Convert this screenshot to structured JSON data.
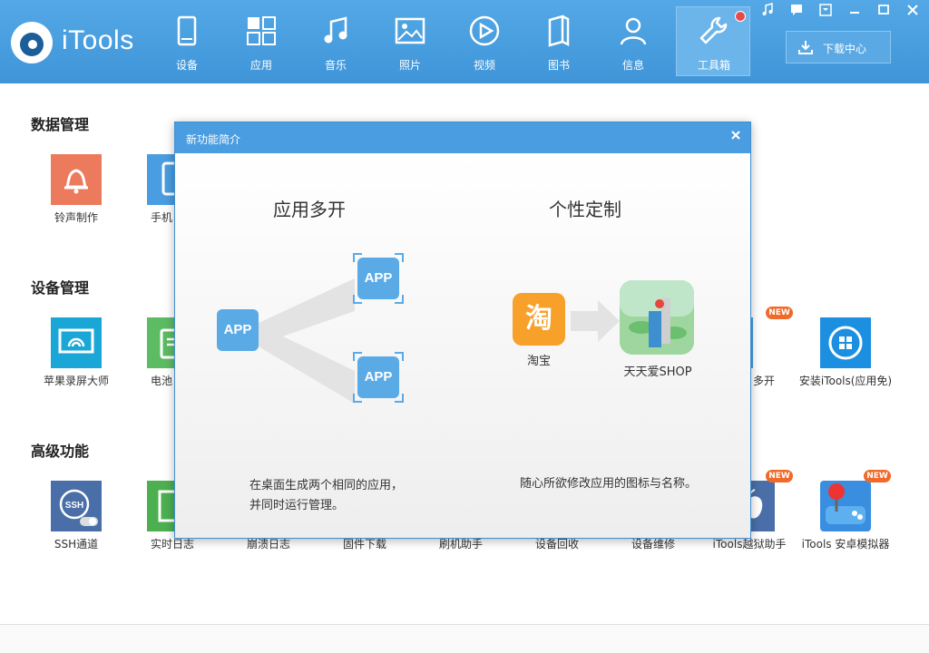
{
  "app": {
    "logo_text": "iTools"
  },
  "nav": [
    {
      "label": "设备",
      "icon": "tablet-icon"
    },
    {
      "label": "应用",
      "icon": "apps-grid-icon"
    },
    {
      "label": "音乐",
      "icon": "music-note-icon"
    },
    {
      "label": "照片",
      "icon": "photo-icon"
    },
    {
      "label": "视频",
      "icon": "play-icon"
    },
    {
      "label": "图书",
      "icon": "book-icon"
    },
    {
      "label": "信息",
      "icon": "person-icon"
    },
    {
      "label": "工具箱",
      "icon": "wrench-icon",
      "active": true
    }
  ],
  "download_button": {
    "label": "下载中心"
  },
  "sections": {
    "data_management": "数据管理",
    "device_management": "设备管理",
    "advanced": "高级功能"
  },
  "tools": {
    "ringtone": "铃声制作",
    "phone_partial": "手机",
    "screen_master": "苹果录屏大师",
    "battery_partial": "电池",
    "multi_open_partial": "多开",
    "install_itools": "安装iTools(应用免)",
    "ssh": "SSH通道",
    "realtime_log": "实时日志",
    "crash_log": "崩溃日志",
    "firmware": "固件下载",
    "flash_helper": "刷机助手",
    "device_recycle": "设备回收",
    "device_repair": "设备维修",
    "jailbreak": "iTools越狱助手",
    "emulator": "iTools 安卓模拟器",
    "new_badge": "NEW"
  },
  "dialog": {
    "title": "新功能简介",
    "left_title": "应用多开",
    "right_title": "个性定制",
    "app_label": "APP",
    "taobao_glyph": "淘",
    "taobao_label": "淘宝",
    "shop_label": "天天爱SHOP",
    "left_desc_line1": "在桌面生成两个相同的应用，",
    "left_desc_line2": "并同时运行管理。",
    "right_desc": "随心所欲修改应用的图标与名称。"
  },
  "colors": {
    "header": "#3f95d8",
    "accent": "#4a9de0",
    "badge": "#f06a2a"
  }
}
